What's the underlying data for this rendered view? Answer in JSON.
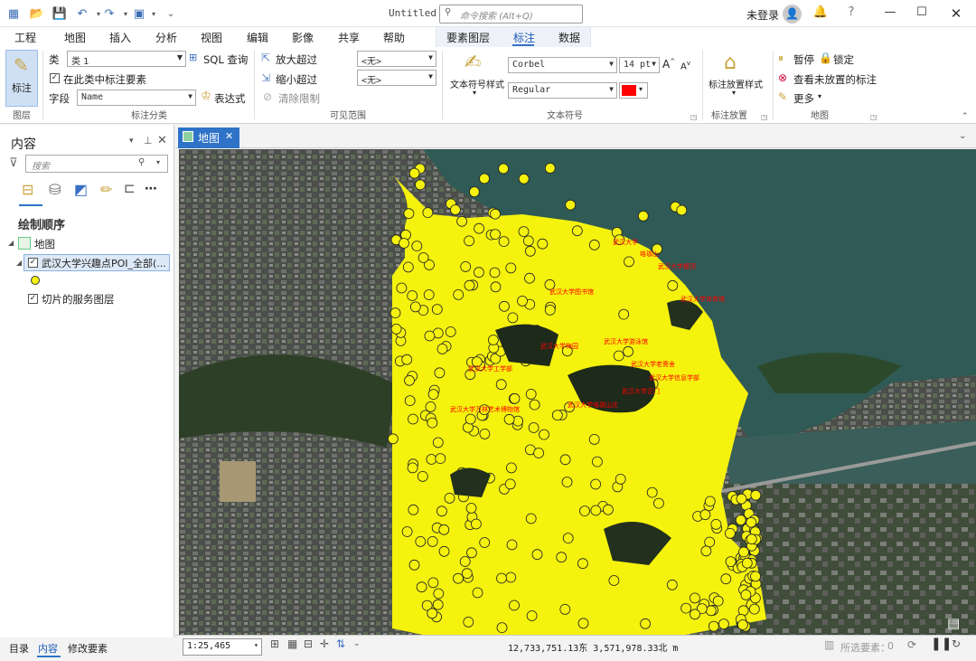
{
  "window": {
    "title": "Untitled",
    "command_search_placeholder": "命令搜索 (Alt+Q)",
    "user": "未登录"
  },
  "menu": {
    "tabs": [
      "工程",
      "地图",
      "插入",
      "分析",
      "视图",
      "编辑",
      "影像",
      "共享",
      "帮助"
    ],
    "context_tabs": [
      "要素图层",
      "标注",
      "数据"
    ],
    "active_tab": "标注"
  },
  "ribbon": {
    "layer": {
      "button": "标注",
      "group": "图层"
    },
    "label_class": {
      "class_label": "类",
      "class_value": "类 1",
      "sql_query": "SQL 查询",
      "label_features_in_class": "在此类中标注要素",
      "field_label": "字段",
      "field_value": "Name",
      "expression": "表达式",
      "group": "标注分类"
    },
    "visibility": {
      "zoom_in_beyond": "放大超过",
      "zoom_out_beyond": "缩小超过",
      "clear_limits": "清除限制",
      "zoom_in_value": "<无>",
      "zoom_out_value": "<无>",
      "group": "可见范围"
    },
    "text_symbol": {
      "style_button": "文本符号样式",
      "font": "Corbel",
      "size": "14 pt",
      "style": "Regular",
      "color": "#ff0000",
      "group": "文本符号"
    },
    "placement": {
      "button": "标注放置样式",
      "group": "标注放置"
    },
    "map": {
      "pause": "暂停",
      "lock": "锁定",
      "view_unplaced": "查看未放置的标注",
      "more": "更多",
      "group": "地图"
    }
  },
  "contents": {
    "title": "内容",
    "search_placeholder": "搜索",
    "draw_order": "绘制顺序",
    "tree": {
      "map": "地图",
      "layer": "武汉大学兴趣点POI_全部(...",
      "basemap": "切片的服务图层"
    },
    "bottom_tabs": [
      "目录",
      "内容",
      "修改要素"
    ],
    "active_bottom_tab": "内容"
  },
  "map": {
    "tab": "地图",
    "poi_color": "#f5f20e",
    "labels": [
      "武汉大学",
      "珞珈山",
      "武汉大学樱顶",
      "武汉大学图书馆",
      "武汉大学体育馆",
      "武汉大学游泳馆",
      "武汉大学梅园",
      "武汉大学工学部",
      "武汉大学信息学部",
      "武汉大学老斋舍",
      "武汉大学正门",
      "武汉大学珞珈山庄",
      "武汉大学万林艺术博物馆"
    ]
  },
  "status": {
    "scale": "1:25,465",
    "coords": "12,733,751.13东 3,571,978.33北 m",
    "selected_label": "所选要素：",
    "selected_count": "0"
  }
}
